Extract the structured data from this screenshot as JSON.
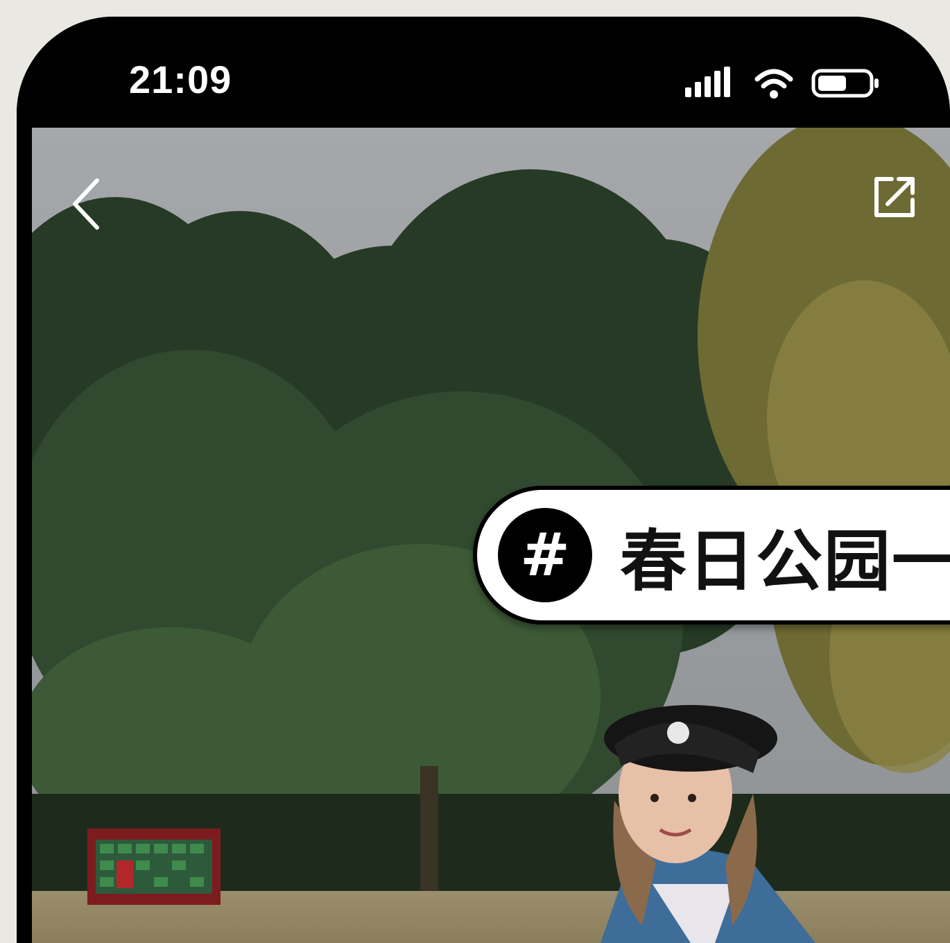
{
  "status_bar": {
    "time": "21:09",
    "signal_icon": "cellular-signal-icon",
    "wifi_icon": "wifi-icon",
    "battery_icon": "battery-icon"
  },
  "nav": {
    "back_icon": "chevron-left-icon",
    "share_icon": "external-share-icon"
  },
  "overlay": {
    "hash_symbol": "#",
    "hashtag_text": "春日公园一"
  },
  "colors": {
    "frame": "#000000",
    "background": "#e9e8e3",
    "pill": "#ffffff"
  }
}
